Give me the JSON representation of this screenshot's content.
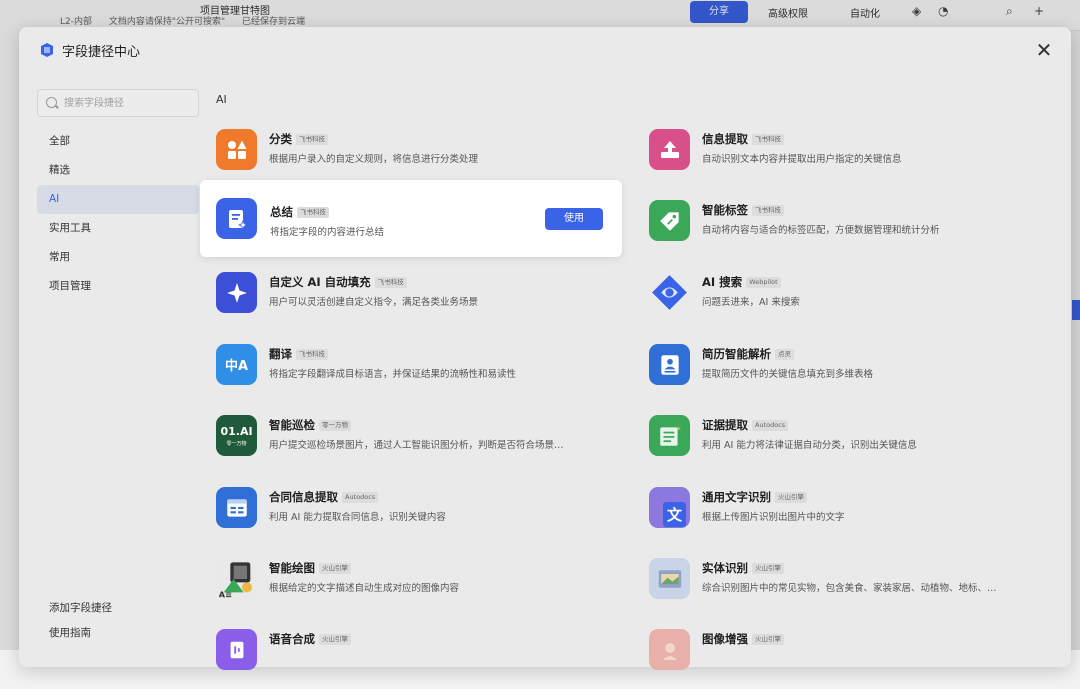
{
  "background": {
    "doc_title": "项目管理甘特图",
    "tabs": [
      "L2-内部",
      "文档内容请保持\"公开可搜索\"",
      "已经保存到云端"
    ],
    "share_label": "分享",
    "advanced_label": "高级权限",
    "automation_label": "自动化"
  },
  "modal": {
    "title": "字段捷径中心",
    "search_placeholder": "搜索字段捷径",
    "section_title": "AI"
  },
  "nav": {
    "items": [
      "全部",
      "精选",
      "AI",
      "实用工具",
      "常用",
      "项目管理"
    ],
    "active_index": 2,
    "bottom": [
      "添加字段捷径",
      "使用指南"
    ]
  },
  "cards": {
    "left": [
      {
        "name": "分类",
        "tag": "飞书科技",
        "desc": "根据用户录入的自定义规则，将信息进行分类处理",
        "icon": "grid-icon",
        "color": "#f07a2c"
      },
      {
        "name": "总结",
        "tag": "飞书科技",
        "desc": "将指定字段的内容进行总结",
        "icon": "summary-doc-icon",
        "color": "#3b63e8"
      },
      {
        "name": "自定义 AI 自动填充",
        "tag": "飞书科技",
        "desc": "用户可以灵活创建自定义指令，满足各类业务场景",
        "icon": "sparkle-icon",
        "color": "#3d4fd6"
      },
      {
        "name": "翻译",
        "tag": "飞书科技",
        "desc": "将指定字段翻译成目标语言，并保证结果的流畅性和易读性",
        "icon": "translate-icon",
        "color": "#2f8ee6",
        "glyph": "中A"
      },
      {
        "name": "智能巡检",
        "tag": "零一万物",
        "desc": "用户提交巡检场景图片，通过人工智能识图分析，判断是否符合场景…",
        "icon": "01ai-logo-icon",
        "color": "#1f5a3a",
        "glyph": "01.AI",
        "subglyph": "零一万物"
      },
      {
        "name": "合同信息提取",
        "tag": "Autodocs",
        "desc": "利用 AI 能力提取合同信息，识别关键内容",
        "icon": "contract-icon",
        "color": "#2f6fd6"
      },
      {
        "name": "智能绘图",
        "tag": "火山引擎",
        "desc": "根据给定的文字描述自动生成对应的图像内容",
        "icon": "image-gen-icon",
        "color": "#e8c95c"
      },
      {
        "name": "语音合成",
        "tag": "火山引擎",
        "desc": "",
        "icon": "voice-icon",
        "color": "#8a5ee8"
      }
    ],
    "right": [
      {
        "name": "信息提取",
        "tag": "飞书科技",
        "desc": "自动识别文本内容并提取出用户指定的关键信息",
        "icon": "extract-icon",
        "color": "#d94f8a"
      },
      {
        "name": "智能标签",
        "tag": "飞书科技",
        "desc": "自动将内容与适合的标签匹配，方便数据管理和统计分析",
        "icon": "tag-icon",
        "color": "#3aa858"
      },
      {
        "name": "AI 搜索",
        "tag": "Webpilot",
        "desc": "问题丢进来，AI 来搜索",
        "icon": "webpilot-icon",
        "color": "#3b63e8"
      },
      {
        "name": "简历智能解析",
        "tag": "点灵",
        "desc": "提取简历文件的关键信息填充到多维表格",
        "icon": "resume-icon",
        "color": "#2f6fd6"
      },
      {
        "name": "证据提取",
        "tag": "Autodocs",
        "desc": "利用 AI 能力将法律证据自动分类，识别出关键信息",
        "icon": "evidence-icon",
        "color": "#3aa858"
      },
      {
        "name": "通用文字识别",
        "tag": "火山引擎",
        "desc": "根据上传图片识别出图片中的文字",
        "icon": "ocr-icon",
        "color": "#3b63e8",
        "glyph": "文"
      },
      {
        "name": "实体识别",
        "tag": "火山引擎",
        "desc": "综合识别图片中的常见实物，包含美食、家装家居、动植物、地标、…",
        "icon": "entity-icon",
        "color": "#b8c6e0"
      },
      {
        "name": "图像增强",
        "tag": "火山引擎",
        "desc": "",
        "icon": "enhance-icon",
        "color": "#e0a0a0"
      }
    ],
    "use_label": "使用",
    "highlight": "left.1"
  }
}
